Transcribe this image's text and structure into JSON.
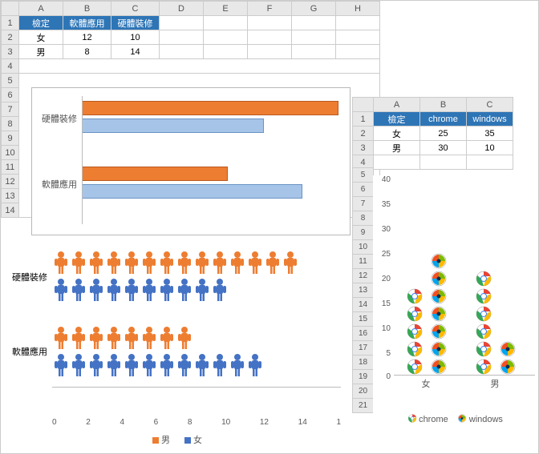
{
  "sheet1": {
    "cols": [
      "A",
      "B",
      "C",
      "D",
      "E",
      "F",
      "G",
      "H"
    ],
    "rows": [
      "1",
      "2",
      "3",
      "4",
      "5",
      "6",
      "7",
      "8",
      "9",
      "10",
      "11",
      "12",
      "13",
      "14"
    ],
    "hdr": {
      "a": "檢定",
      "b": "軟體應用",
      "c": "硬體裝修"
    },
    "r2": {
      "a": "女",
      "b": "12",
      "c": "10"
    },
    "r3": {
      "a": "男",
      "b": "8",
      "c": "14"
    }
  },
  "sheet2": {
    "cols": [
      "A",
      "B",
      "C"
    ],
    "rows": [
      "1",
      "2",
      "3",
      "4"
    ],
    "hdr": {
      "a": "檢定",
      "b": "chrome",
      "c": "windows"
    },
    "r2": {
      "a": "女",
      "b": "25",
      "c": "35"
    },
    "r3": {
      "a": "男",
      "b": "30",
      "c": "10"
    }
  },
  "rowstrip": [
    "5",
    "6",
    "7",
    "8",
    "9",
    "10",
    "11",
    "12",
    "13",
    "14",
    "15",
    "16",
    "17",
    "18",
    "19",
    "20",
    "21"
  ],
  "chart1": {
    "cat1": "硬體裝修",
    "cat2": "軟體應用"
  },
  "chart2": {
    "cat1": "硬體裝修",
    "cat2": "軟體應用",
    "ticks": {
      "t0": "0",
      "t2": "2",
      "t4": "4",
      "t6": "6",
      "t8": "8",
      "t10": "10",
      "t12": "12",
      "t14": "14",
      "t15": "1"
    },
    "legend": {
      "m": "男",
      "f": "女"
    }
  },
  "chart3": {
    "yticks": {
      "y40": "40",
      "y35": "35",
      "y30": "30",
      "y25": "25",
      "y20": "20",
      "y15": "15",
      "y10": "10",
      "y5": "5",
      "y0": "0"
    },
    "xcat": {
      "f": "女",
      "m": "男"
    },
    "legend": {
      "c": "chrome",
      "w": "windows"
    }
  },
  "chart_data": [
    {
      "type": "bar",
      "orientation": "horizontal",
      "categories": [
        "硬體裝修",
        "軟體應用"
      ],
      "series": [
        {
          "name": "男",
          "values": [
            14,
            8
          ],
          "color": "#ed7d31"
        },
        {
          "name": "女",
          "values": [
            10,
            12
          ],
          "color": "#a6c4e8"
        }
      ],
      "title": "",
      "xlabel": "",
      "ylabel": ""
    },
    {
      "type": "bar",
      "subtype": "pictogram",
      "orientation": "horizontal",
      "categories": [
        "硬體裝修",
        "軟體應用"
      ],
      "series": [
        {
          "name": "男",
          "values": [
            14,
            8
          ],
          "color": "#ed7d31"
        },
        {
          "name": "女",
          "values": [
            10,
            12
          ],
          "color": "#4472c4"
        }
      ],
      "xlim": [
        0,
        15
      ]
    },
    {
      "type": "bar",
      "subtype": "pictogram",
      "orientation": "vertical",
      "categories": [
        "女",
        "男"
      ],
      "series": [
        {
          "name": "chrome",
          "values": [
            25,
            30
          ],
          "icon": "chrome"
        },
        {
          "name": "windows",
          "values": [
            35,
            10
          ],
          "icon": "windows"
        }
      ],
      "ylim": [
        0,
        40
      ]
    }
  ]
}
